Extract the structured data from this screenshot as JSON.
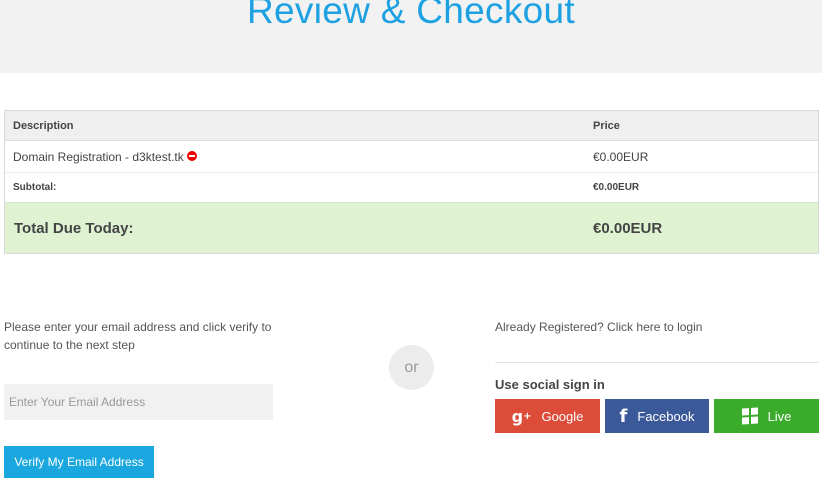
{
  "page": {
    "title": "Review & Checkout"
  },
  "cart": {
    "headers": {
      "description": "Description",
      "price": "Price"
    },
    "items": [
      {
        "description": "Domain Registration - d3ktest.tk",
        "price": "€0.00EUR"
      }
    ],
    "subtotal": {
      "label": "Subtotal:",
      "value": "€0.00EUR"
    },
    "total": {
      "label": "Total Due Today:",
      "value": "€0.00EUR"
    }
  },
  "verify": {
    "instructions": "Please enter your email address and click verify to continue to the next step",
    "email_placeholder": "Enter Your Email Address",
    "email_value": "",
    "button_label": "Verify My Email Address"
  },
  "separator": {
    "label": "or"
  },
  "login": {
    "link_label": "Already Registered? Click here to login",
    "social_title": "Use social sign in",
    "buttons": [
      {
        "label": "Google",
        "icon": "google-plus-icon",
        "color": "#dd4b39"
      },
      {
        "label": "Facebook",
        "icon": "facebook-icon",
        "color": "#3b5998"
      },
      {
        "label": "Live",
        "icon": "windows-live-icon",
        "color": "#3aab2b"
      }
    ]
  },
  "colors": {
    "accent": "#1da1e2",
    "total_bg": "#dff3d3",
    "verify_button": "#1aa7e0"
  }
}
